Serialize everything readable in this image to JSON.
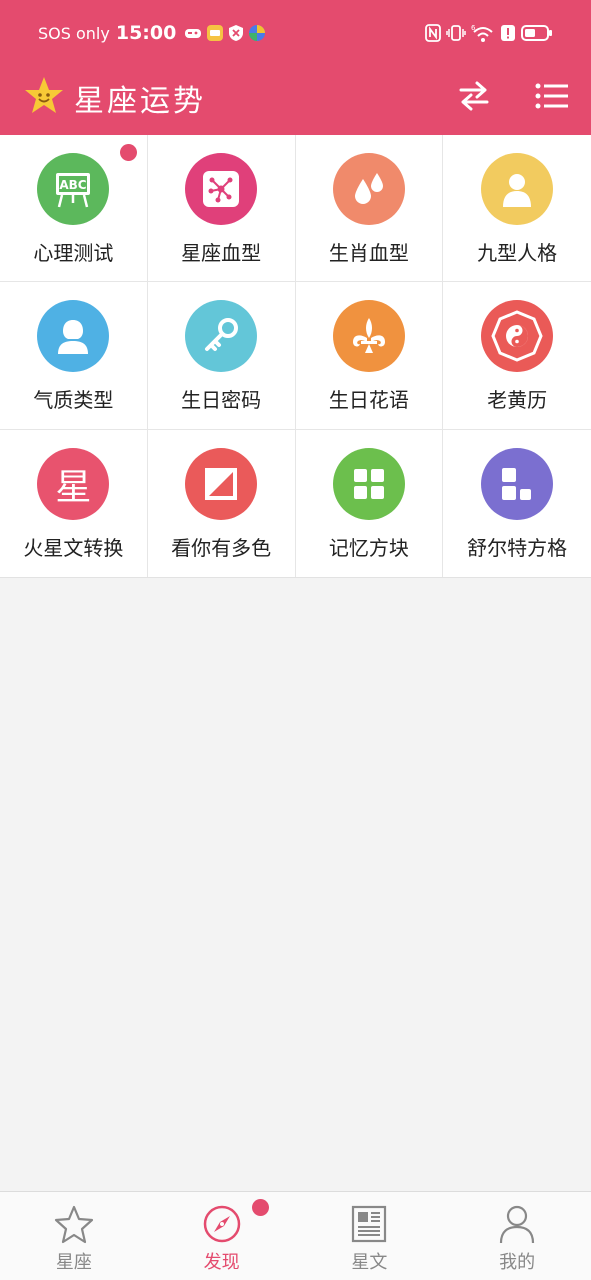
{
  "status_bar": {
    "carrier": "SOS only",
    "time": "15:00",
    "network": "6"
  },
  "app_bar": {
    "title": "星座运势"
  },
  "grid_items": [
    {
      "label": "心理测试",
      "icon": "abc-board-icon",
      "color": "#5cb85c",
      "badge": true
    },
    {
      "label": "星座血型",
      "icon": "constellation-icon",
      "color": "#e0407a"
    },
    {
      "label": "生肖血型",
      "icon": "blood-drops-icon",
      "color": "#f08a6b"
    },
    {
      "label": "九型人格",
      "icon": "person-icon",
      "color": "#f2cb5f"
    },
    {
      "label": "气质类型",
      "icon": "woman-icon",
      "color": "#4fb1e4"
    },
    {
      "label": "生日密码",
      "icon": "key-icon",
      "color": "#63c6d8"
    },
    {
      "label": "生日花语",
      "icon": "fleur-de-lis-icon",
      "color": "#f0923f"
    },
    {
      "label": "老黄历",
      "icon": "bagua-icon",
      "color": "#ea5a57"
    },
    {
      "label": "火星文转换",
      "icon": "xing-char-icon",
      "glyph": "星",
      "color": "#e8536e"
    },
    {
      "label": "看你有多色",
      "icon": "color-square-icon",
      "color": "#ea5a5a"
    },
    {
      "label": "记忆方块",
      "icon": "four-blocks-icon",
      "color": "#6cbf4d"
    },
    {
      "label": "舒尔特方格",
      "icon": "schulte-blocks-icon",
      "color": "#7b6fd0"
    }
  ],
  "bottom_nav": [
    {
      "label": "星座",
      "icon": "star-outline-icon"
    },
    {
      "label": "发现",
      "icon": "compass-icon",
      "active": true,
      "badge": true
    },
    {
      "label": "星文",
      "icon": "newspaper-icon"
    },
    {
      "label": "我的",
      "icon": "user-icon"
    }
  ],
  "colors": {
    "primary": "#e44b6e",
    "background": "#f3f3f3",
    "inactive": "#888888"
  }
}
